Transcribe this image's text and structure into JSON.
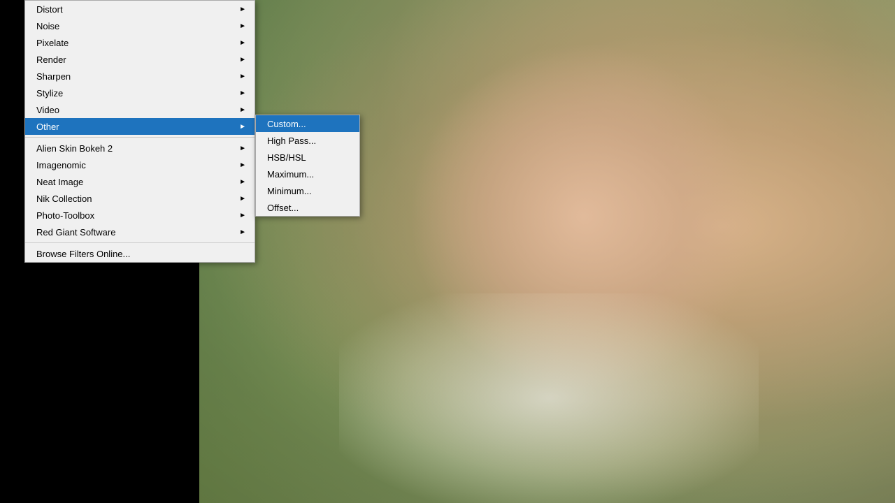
{
  "background": {
    "leftColor": "#000000",
    "photoLeft": 285
  },
  "menu": {
    "items": [
      {
        "label": "Distort",
        "hasSubmenu": true,
        "active": false
      },
      {
        "label": "Noise",
        "hasSubmenu": true,
        "active": false
      },
      {
        "label": "Pixelate",
        "hasSubmenu": true,
        "active": false
      },
      {
        "label": "Render",
        "hasSubmenu": true,
        "active": false
      },
      {
        "label": "Sharpen",
        "hasSubmenu": true,
        "active": false
      },
      {
        "label": "Stylize",
        "hasSubmenu": true,
        "active": false
      },
      {
        "label": "Video",
        "hasSubmenu": true,
        "active": false
      },
      {
        "label": "Other",
        "hasSubmenu": true,
        "active": true
      },
      {
        "label": "Alien Skin Bokeh 2",
        "hasSubmenu": true,
        "active": false
      },
      {
        "label": "Imagenomic",
        "hasSubmenu": true,
        "active": false
      },
      {
        "label": "Neat Image",
        "hasSubmenu": true,
        "active": false
      },
      {
        "label": "Nik Collection",
        "hasSubmenu": true,
        "active": false
      },
      {
        "label": "Photo-Toolbox",
        "hasSubmenu": true,
        "active": false
      },
      {
        "label": "Red Giant Software",
        "hasSubmenu": true,
        "active": false
      }
    ],
    "bottomItem": {
      "label": "Browse Filters Online...",
      "hasSubmenu": false
    }
  },
  "submenu": {
    "items": [
      {
        "label": "Custom...",
        "active": true
      },
      {
        "label": "High Pass...",
        "active": false
      },
      {
        "label": "HSB/HSL",
        "active": false
      },
      {
        "label": "Maximum...",
        "active": false
      },
      {
        "label": "Minimum...",
        "active": false
      },
      {
        "label": "Offset...",
        "active": false
      }
    ]
  }
}
